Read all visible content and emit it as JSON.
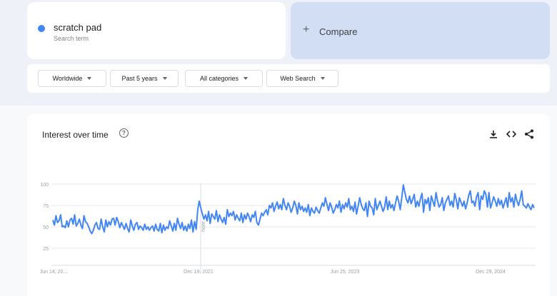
{
  "search_term": {
    "name": "scratch pad",
    "subtitle": "Search term",
    "color": "#4285f4"
  },
  "compare": {
    "plus": "+",
    "label": "Compare"
  },
  "filters": [
    {
      "label": "Worldwide"
    },
    {
      "label": "Past 5 years"
    },
    {
      "label": "All categories"
    },
    {
      "label": "Web Search"
    }
  ],
  "chart": {
    "title": "Interest over time",
    "help_icon": "help-icon",
    "tools": [
      "download-icon",
      "embed-code-icon",
      "share-icon"
    ]
  },
  "chart_data": {
    "type": "line",
    "series": [
      {
        "color": "#4285f4",
        "values": [
          58,
          52,
          63,
          55,
          57,
          64,
          50,
          51,
          49,
          57,
          50,
          58,
          60,
          53,
          64,
          51,
          54,
          59,
          52,
          48,
          63,
          56,
          54,
          50,
          45,
          42,
          46,
          52,
          55,
          48,
          47,
          59,
          50,
          44,
          58,
          50,
          56,
          52,
          59,
          60,
          52,
          61,
          56,
          49,
          55,
          51,
          47,
          54,
          48,
          44,
          58,
          51,
          46,
          53,
          55,
          47,
          51,
          49,
          46,
          53,
          47,
          50,
          46,
          49,
          51,
          45,
          53,
          47,
          45,
          54,
          43,
          52,
          46,
          50,
          48,
          57,
          51,
          45,
          54,
          46,
          60,
          53,
          48,
          55,
          46,
          51,
          45,
          53,
          48,
          58,
          44,
          56,
          47,
          70,
          80,
          72,
          65,
          59,
          64,
          57,
          68,
          54,
          65,
          62,
          59,
          69,
          56,
          64,
          59,
          55,
          61,
          53,
          70,
          62,
          66,
          63,
          68,
          58,
          64,
          60,
          57,
          66,
          55,
          64,
          59,
          66,
          62,
          56,
          64,
          61,
          68,
          55,
          52,
          59,
          66,
          63,
          67,
          70,
          64,
          75,
          72,
          78,
          68,
          74,
          79,
          71,
          76,
          70,
          83,
          75,
          70,
          78,
          74,
          67,
          72,
          80,
          75,
          65,
          78,
          70,
          74,
          68,
          72,
          67,
          76,
          63,
          72,
          68,
          66,
          73,
          69,
          66,
          72,
          78,
          74,
          84,
          76,
          69,
          78,
          73,
          66,
          70,
          76,
          72,
          80,
          67,
          76,
          71,
          78,
          73,
          83,
          70,
          74,
          68,
          79,
          65,
          74,
          84,
          76,
          71,
          69,
          78,
          62,
          80,
          74,
          72,
          64,
          83,
          70,
          75,
          80,
          74,
          68,
          73,
          85,
          70,
          80,
          72,
          76,
          69,
          78,
          86,
          80,
          70,
          84,
          99,
          90,
          82,
          78,
          86,
          77,
          82,
          88,
          73,
          80,
          74,
          83,
          89,
          67,
          82,
          77,
          84,
          69,
          86,
          80,
          74,
          90,
          80,
          73,
          76,
          84,
          69,
          78,
          82,
          86,
          75,
          80,
          73,
          89,
          82,
          71,
          84,
          79,
          74,
          80,
          71,
          78,
          87,
          92,
          78,
          80,
          74,
          85,
          90,
          70,
          86,
          82,
          92,
          88,
          73,
          90,
          72,
          78,
          85,
          80,
          74,
          83,
          76,
          81,
          72,
          78,
          84,
          73,
          90,
          79,
          84,
          73,
          88,
          80,
          75,
          82,
          92,
          76,
          74,
          72,
          77,
          73,
          70,
          76,
          72
        ],
        "date_labels_index": {
          "start": 0,
          "mid1": 106,
          "mid2": 186,
          "end": 267
        }
      }
    ],
    "x_ticks": [
      "Jun 14, 20...",
      "Dec 19, 2021",
      "Jun 25, 2023",
      "Dec 29, 2024"
    ],
    "y_ticks": [
      "100",
      "75",
      "50",
      "25"
    ],
    "ylim": [
      0,
      100
    ],
    "grid": true,
    "annotation": "Note"
  }
}
